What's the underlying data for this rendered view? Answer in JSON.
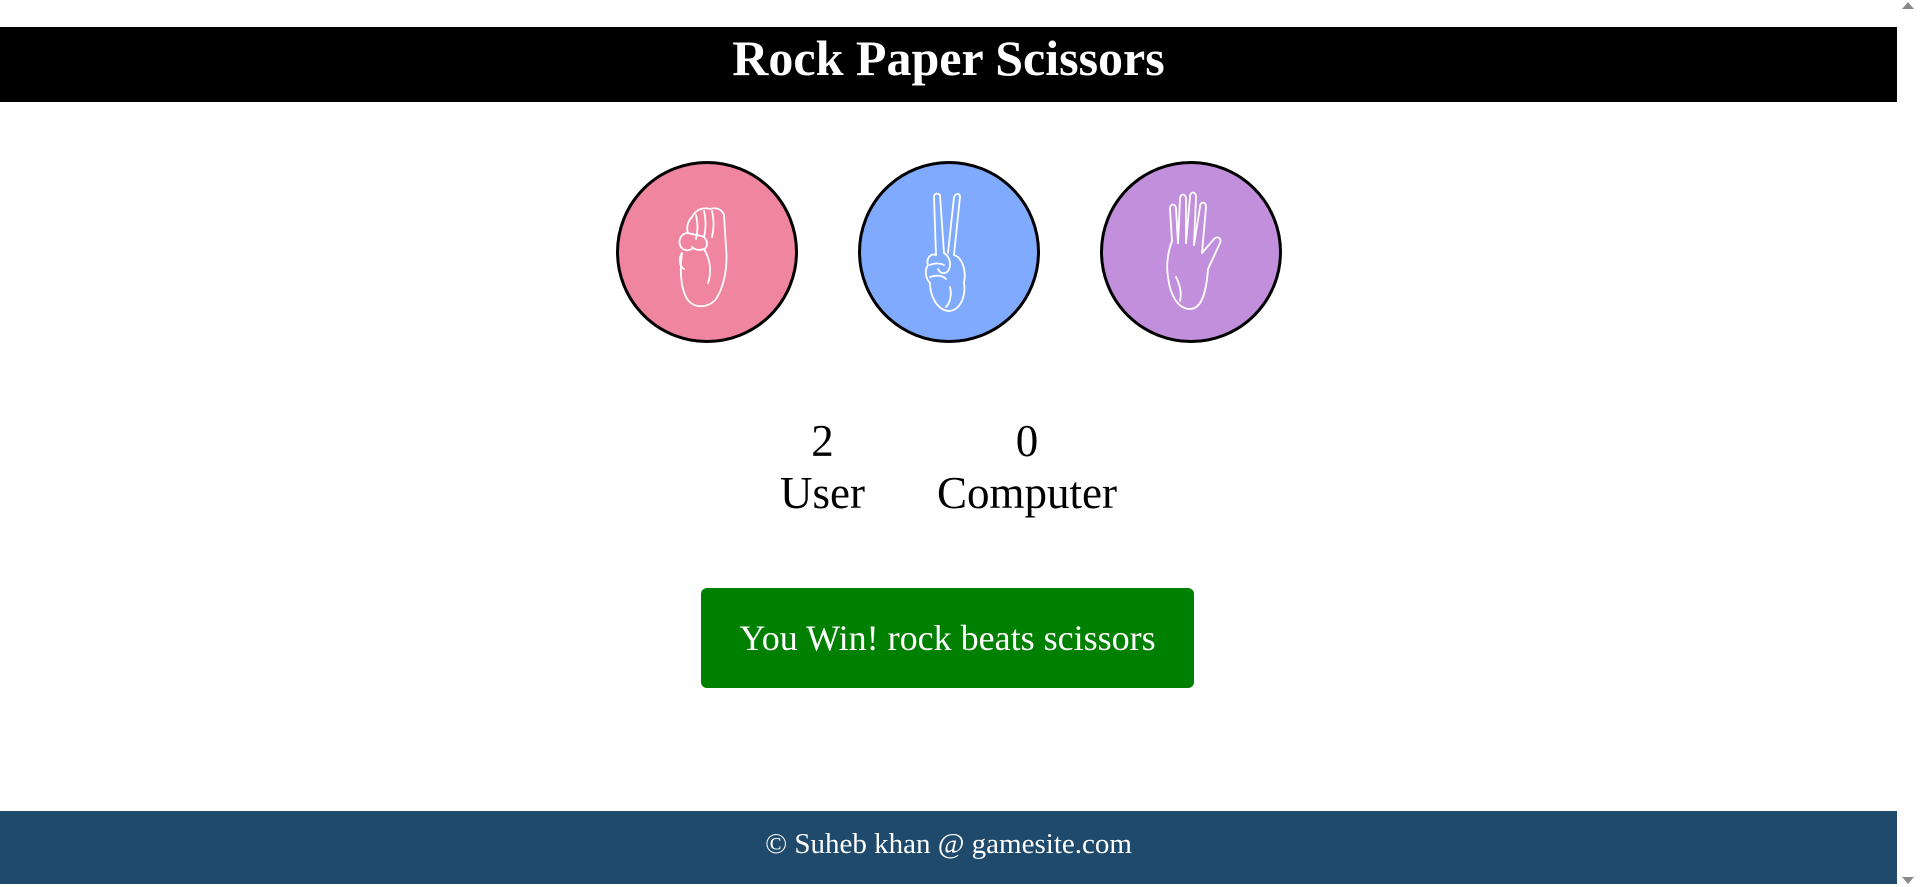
{
  "header": {
    "title": "Rock Paper Scissors",
    "background": "#000000"
  },
  "choices": [
    {
      "name": "rock",
      "icon": "rock-fist-icon",
      "color": "#f0859f"
    },
    {
      "name": "scissors",
      "icon": "scissors-hand-icon",
      "color": "#80aafd"
    },
    {
      "name": "paper",
      "icon": "paper-hand-icon",
      "color": "#c28fdc"
    }
  ],
  "scoreboard": {
    "user_score": "2",
    "user_label": "User",
    "computer_score": "0",
    "computer_label": "Computer"
  },
  "result": {
    "message": "You Win! rock beats scissors",
    "color": "#008000"
  },
  "footer": {
    "text": "© Suheb khan @ gamesite.com",
    "background": "#1f4a6b"
  }
}
